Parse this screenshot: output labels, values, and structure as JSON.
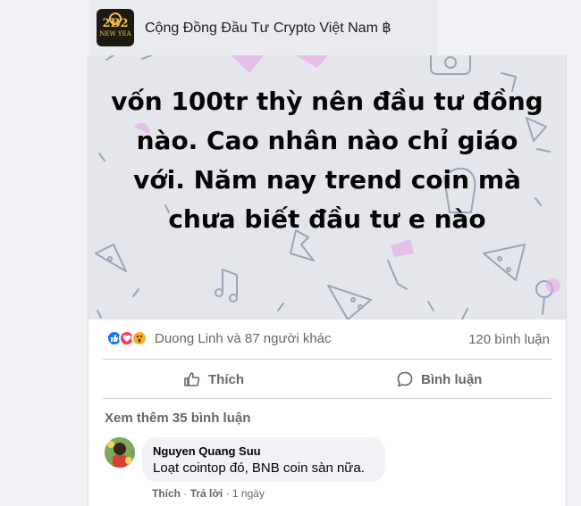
{
  "group": {
    "name": "Cộng Đồng Đầu Tư Crypto Việt Nam ฿",
    "avatar_text": "2B2",
    "avatar_sub": "NEW YEA"
  },
  "post": {
    "text": "vốn 100tr thỳ nên đầu tư đồng nào. Cao nhân nào chỉ giáo với. Năm nay trend coin mà chưa biết đầu tư e nào",
    "background_color": "#e4e6eb"
  },
  "reactions": {
    "text": "Duong Linh và 87 người khác",
    "comment_count": "120 bình luận",
    "icons": [
      "like-icon",
      "love-icon",
      "wow-icon"
    ]
  },
  "actions": {
    "like_label": "Thích",
    "comment_label": "Bình luận"
  },
  "comments": {
    "see_more": "Xem thêm 35 bình luận",
    "items": [
      {
        "author": "Nguyen Quang Suu",
        "text": "Loạt cointop đó, BNB coin sàn nữa.",
        "like": "Thích",
        "reply": "Trả lời",
        "time": "1 ngày"
      }
    ]
  },
  "colors": {
    "accent": "#1877f2",
    "love": "#f33e58",
    "muted_text": "#65676b"
  }
}
